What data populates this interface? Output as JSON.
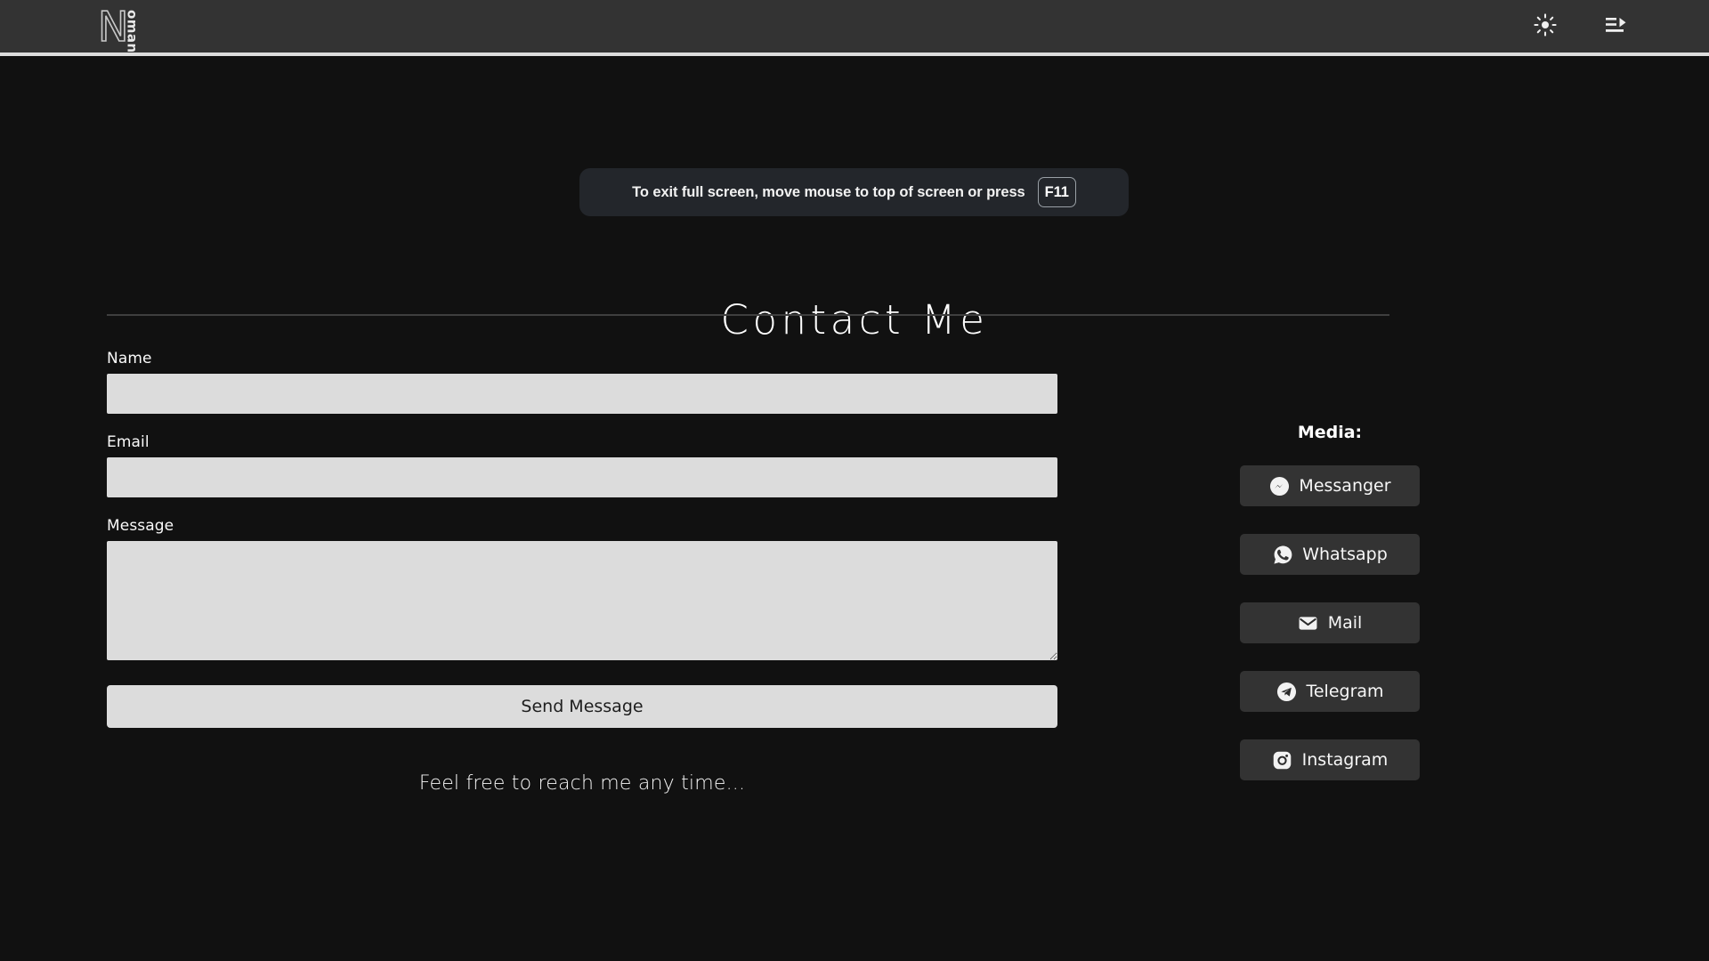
{
  "topbar": {
    "logo_initial": "N",
    "logo_rest": "oman",
    "theme_toggle_icon": "sun-icon",
    "menu_icon": "indent-menu-icon"
  },
  "fullscreen_notice": {
    "text": "To exit full screen, move mouse to top of screen or press",
    "key": "F11"
  },
  "page": {
    "title": "Contact Me"
  },
  "form": {
    "name": {
      "label": "Name",
      "value": "",
      "placeholder": ""
    },
    "email": {
      "label": "Email",
      "value": "",
      "placeholder": ""
    },
    "message": {
      "label": "Message",
      "value": "",
      "placeholder": ""
    },
    "submit_label": "Send Message",
    "footnote": "Feel free to reach me any time..."
  },
  "media": {
    "heading": "Media:",
    "items": [
      {
        "label": "Messanger",
        "icon": "messenger-icon"
      },
      {
        "label": "Whatsapp",
        "icon": "whatsapp-icon"
      },
      {
        "label": "Mail",
        "icon": "mail-icon"
      },
      {
        "label": "Telegram",
        "icon": "telegram-icon"
      },
      {
        "label": "Instagram",
        "icon": "instagram-icon"
      }
    ]
  },
  "colors": {
    "page_bg": "#111111",
    "topbar_bg": "#333333",
    "topbar_underline": "#dddddd",
    "input_bg": "#dcdcdc",
    "media_btn_bg": "#333333",
    "banner_bg": "#23262b",
    "divider": "#3f3f3f"
  }
}
